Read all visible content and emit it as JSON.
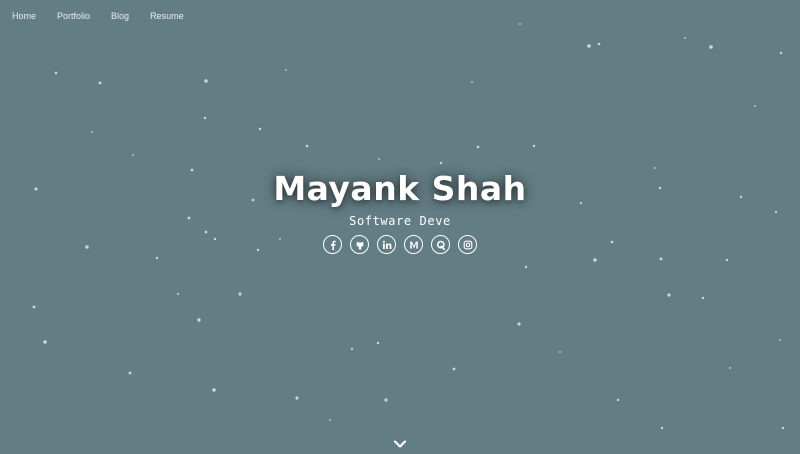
{
  "nav": {
    "items": [
      {
        "label": "Home"
      },
      {
        "label": "Portfolio"
      },
      {
        "label": "Blog"
      },
      {
        "label": "Resume"
      }
    ]
  },
  "hero": {
    "name": "Mayank Shah",
    "role": "Software Deve"
  },
  "socials": [
    "facebook-icon",
    "github-icon",
    "linkedin-icon",
    "medium-icon",
    "quora-icon",
    "instagram-icon"
  ],
  "colors": {
    "background": "#637d84",
    "text": "#ffffff",
    "particle": "#dfe7ea"
  }
}
